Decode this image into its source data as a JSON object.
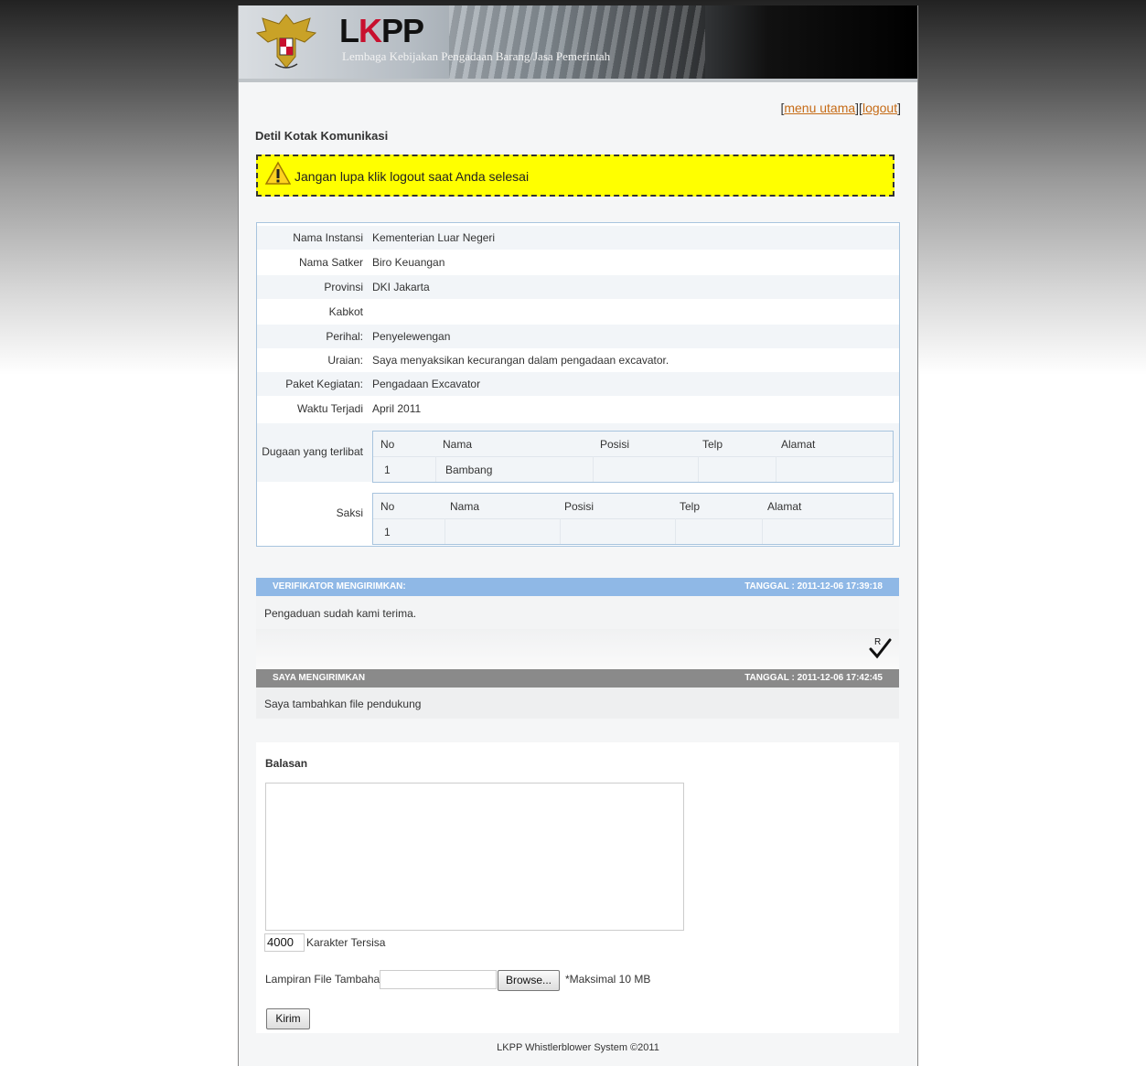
{
  "header": {
    "logo_prefix": "L",
    "logo_accent": "K",
    "logo_suffix": "PP",
    "subtitle": "Lembaga Kebijakan Pengadaan Barang/Jasa Pemerintah"
  },
  "nav": {
    "menu_label": "menu utama",
    "logout_label": "logout"
  },
  "page_title": "Detil Kotak Komunikasi",
  "warning": {
    "text": "Jangan lupa klik logout saat Anda selesai"
  },
  "detail": {
    "rows": [
      {
        "label": "Nama Instansi",
        "value": "Kementerian Luar Negeri"
      },
      {
        "label": "Nama Satker",
        "value": "Biro Keuangan"
      },
      {
        "label": "Provinsi",
        "value": "DKI Jakarta"
      },
      {
        "label": "Kabkot",
        "value": ""
      },
      {
        "label": "Perihal:",
        "value": "Penyelewengan"
      },
      {
        "label": "Uraian:",
        "value": "Saya menyaksikan kecurangan dalam pengadaan excavator."
      },
      {
        "label": "Paket Kegiatan:",
        "value": "Pengadaan Excavator"
      },
      {
        "label": "Waktu Terjadi",
        "value": "April 2011"
      }
    ],
    "suspects": {
      "label": "Dugaan yang terlibat",
      "columns": [
        "No",
        "Nama",
        "Posisi",
        "Telp",
        "Alamat"
      ],
      "rows": [
        {
          "no": "1",
          "nama": "Bambang",
          "posisi": "",
          "telp": "",
          "alamat": ""
        }
      ]
    },
    "witnesses": {
      "label": "Saksi",
      "columns": [
        "No",
        "Nama",
        "Posisi",
        "Telp",
        "Alamat"
      ],
      "rows": [
        {
          "no": "1",
          "nama": "",
          "posisi": "",
          "telp": "",
          "alamat": ""
        }
      ]
    }
  },
  "messages": [
    {
      "sender": "VERIFIKATOR MENGIRIMKAN:",
      "date": "TANGGAL : 2011-12-06 17:39:18",
      "text": "Pengaduan sudah kami terima.",
      "read_mark": "R"
    },
    {
      "sender": "SAYA MENGIRIMKAN",
      "date": "TANGGAL : 2011-12-06 17:42:45",
      "text": "Saya tambahkan file pendukung"
    }
  ],
  "reply": {
    "title": "Balasan",
    "counter_value": "4000",
    "counter_label": "Karakter Tersisa",
    "attachment_label": "Lampiran File Tambahan",
    "browse_label": "Browse...",
    "max_label": "*Maksimal 10 MB",
    "submit_label": "Kirim"
  },
  "footer": "LKPP Whistlerblower System ©2011",
  "colors": {
    "link": "#c66b16",
    "warning_bg": "#ffff00",
    "verifier_bar": "#8fb8e6",
    "own_bar": "#8a8a8a"
  }
}
